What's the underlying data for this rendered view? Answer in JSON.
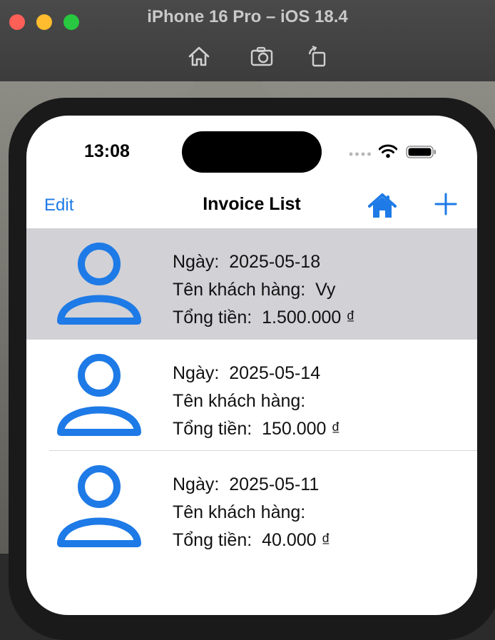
{
  "window": {
    "title": "iPhone 16 Pro – iOS 18.4",
    "toolbar_icons": [
      "home-icon",
      "screenshot-icon",
      "rotate-icon"
    ]
  },
  "status_bar": {
    "time": "13:08"
  },
  "nav": {
    "edit_label": "Edit",
    "title": "Invoice List"
  },
  "invoices": [
    {
      "date_label": "Ngày:",
      "date": "2025-05-18",
      "customer_label": "Tên khách hàng:",
      "customer": "Vy",
      "total_label": "Tổng tiền:",
      "total": "1.500.000 ₫",
      "selected": true
    },
    {
      "date_label": "Ngày:",
      "date": "2025-05-14",
      "customer_label": "Tên khách hàng:",
      "customer": "",
      "total_label": "Tổng tiền:",
      "total": "150.000 ₫",
      "selected": false
    },
    {
      "date_label": "Ngày:",
      "date": "2025-05-11",
      "customer_label": "Tên khách hàng:",
      "customer": "",
      "total_label": "Tổng tiền:",
      "total": "40.000 ₫",
      "selected": false
    }
  ],
  "colors": {
    "accent": "#1e7ae6",
    "selected_row": "#d1d1d6"
  }
}
